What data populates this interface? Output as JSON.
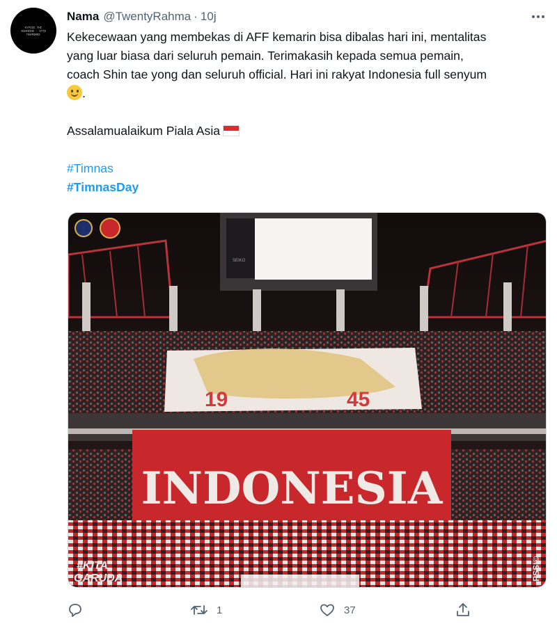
{
  "tweet": {
    "avatar_text": "ΚΥΡΙΟΣ ΤΗΣ ΑΝΑΘΕΣΗΣ · ΟΥΤΕ ΠΛΗΡΩΜΗΣ",
    "author_name": "Nama",
    "author_handle": "@TwentyRahma",
    "separator": "·",
    "timestamp": "10j",
    "more_icon": "more-horizontal-icon",
    "text_lines": [
      "Kekecewaan yang membekas di AFF kemarin bisa dibalas hari ini, mentalitas",
      "yang luar biasa dari seluruh pemain. Terimakasih kepada semua pemain,",
      "coach Shin tae yong dan seluruh official. Hari ini rakyat Indonesia full senyum"
    ],
    "text_end": ".",
    "emoji_smile": "slightly-smiling-face-emoji",
    "line2": "Assalamualaikum Piala Asia",
    "flag": "indonesia-flag-emoji",
    "hashtags": [
      "#Timnas",
      "#TimnasDay"
    ]
  },
  "media": {
    "banner_year_left": "19",
    "banner_year_right": "45",
    "banner_main_text": "INDONESIA",
    "watermark_left": [
      "#KITA",
      "GARUDA"
    ],
    "watermark_right": "PSSI©",
    "scoreboard_brand": "SEIKO",
    "colors": {
      "banner_red": "#c8272c",
      "stadium_dark": "#1a1414"
    }
  },
  "actions": {
    "reply": {
      "icon": "reply-icon",
      "count": ""
    },
    "retweet": {
      "icon": "retweet-icon",
      "count": "1"
    },
    "like": {
      "icon": "heart-icon",
      "count": "37"
    },
    "share": {
      "icon": "share-icon",
      "count": ""
    }
  }
}
